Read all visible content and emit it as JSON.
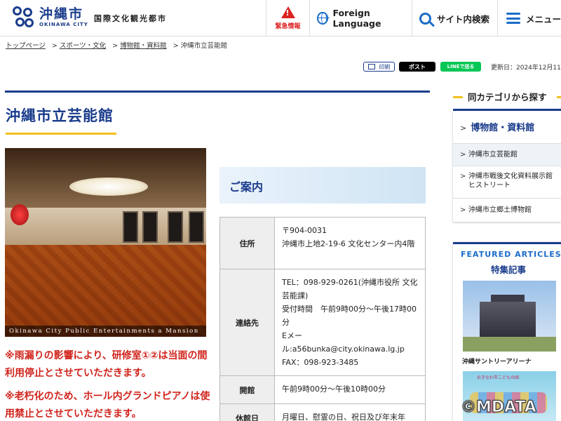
{
  "header": {
    "logo_jp": "沖縄市",
    "logo_en": "OKINAWA CITY",
    "slogan": "国際文化観光都市",
    "emergency_label": "緊急情報",
    "language_label": "Foreign Language",
    "search_label": "サイト内検索",
    "menu_label": "メニュー"
  },
  "breadcrumb": {
    "items": [
      "トップページ",
      "スポーツ・文化",
      "博物館・資料館"
    ],
    "current": "沖縄市立芸能館"
  },
  "share": {
    "print_label": "印刷",
    "x_label": "ポスト",
    "line_label": "LINEで送る",
    "updated": "更新日：2024年12月11日"
  },
  "main": {
    "title": "沖縄市立芸能館",
    "photo_caption": "Okinawa City Public Entertainments a Mansion",
    "notices": [
      "※雨漏りの影響により、研修室①②は当面の間利用停止とさせていただきます。",
      "※老朽化のため、ホール内グランドピアノは使用禁止とさせていただきます。"
    ],
    "guide_heading": "ご案内",
    "table": [
      {
        "label": "住所",
        "lines": [
          "〒904-0031",
          "沖縄市上地2-19-6 文化センター内4階"
        ]
      },
      {
        "label": "連絡先",
        "lines": [
          "TEL：098-929-0261(沖縄市役所 文化芸能課)",
          "受付時間　午前9時00分～午後17時00分",
          "Eメール:a56bunka@city.okinawa.lg.jp",
          "FAX：098-923-3485"
        ]
      },
      {
        "label": "開館",
        "lines": [
          "午前9時00分～午後10時00分"
        ]
      },
      {
        "label": "休館日",
        "lines": [
          "月曜日、慰霊の日、祝日及び年末年"
        ]
      }
    ]
  },
  "sidebar": {
    "heading": "同カテゴリから探す",
    "category": "博物館・資料館",
    "items": [
      "沖縄市立芸能館",
      "沖縄市戦後文化資料展示館ヒストリート",
      "沖縄市立郷土博物館"
    ],
    "featured_en": "FEATURED ARTICLES",
    "featured_jp": "特集記事",
    "featured_caption": "沖縄サントリーアリーナ",
    "featured_img2_text": "おきなわ市こどもの国"
  },
  "watermark": "©MDATA"
}
